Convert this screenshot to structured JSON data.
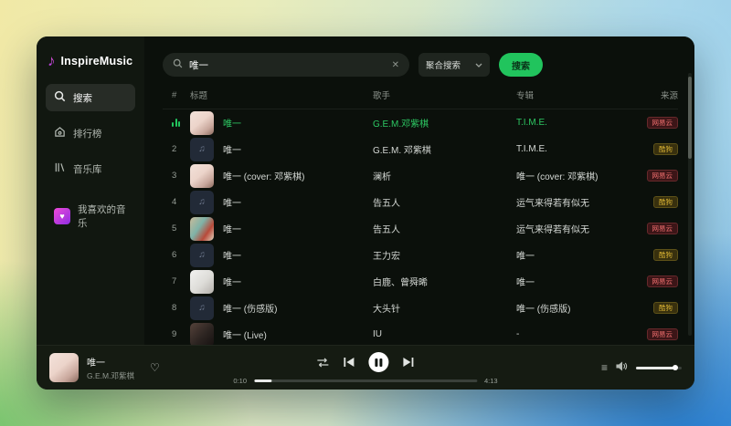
{
  "app": {
    "name": "InspireMusic"
  },
  "icons": {
    "logo_note": "♪",
    "heart_tile": "♥",
    "heart_outline": "♡",
    "clear": "✕",
    "note_placeholder": "♫",
    "queue": "≡"
  },
  "colors": {
    "accent_green": "#21c45d",
    "playing_green": "#2dc863",
    "badge_red": "#ef6e6e",
    "badge_yellow": "#d9b233",
    "logo_pink": "#f25ad2"
  },
  "sidebar": {
    "items": [
      {
        "label": "搜索",
        "icon": "search-icon",
        "active": true
      },
      {
        "label": "排行榜",
        "icon": "home-icon",
        "active": false
      },
      {
        "label": "音乐库",
        "icon": "library-icon",
        "active": false
      }
    ],
    "liked_label": "我喜欢的音乐"
  },
  "search": {
    "query": "唯一",
    "mode": "聚合搜索",
    "button_label": "搜索"
  },
  "table": {
    "headers": {
      "index": "#",
      "title": "标题",
      "artist": "歌手",
      "album": "专辑",
      "source": "来源"
    },
    "rows": [
      {
        "index": "",
        "playing": true,
        "title": "唯一",
        "artist": "G.E.M.邓紫棋",
        "album": "T.I.M.E.",
        "source": "网易云",
        "source_color": "red",
        "art": "photo1"
      },
      {
        "index": "2",
        "playing": false,
        "title": "唯一",
        "artist": "G.E.M. 邓紫棋",
        "album": "T.I.M.E.",
        "source": "酷狗",
        "source_color": "yellow",
        "art": "note"
      },
      {
        "index": "3",
        "playing": false,
        "title": "唯一 (cover: 邓紫棋)",
        "artist": "澜析",
        "album": "唯一 (cover: 邓紫棋)",
        "source": "网易云",
        "source_color": "red",
        "art": "photo1"
      },
      {
        "index": "4",
        "playing": false,
        "title": "唯一",
        "artist": "告五人",
        "album": "运气来得若有似无",
        "source": "酷狗",
        "source_color": "yellow",
        "art": "note"
      },
      {
        "index": "5",
        "playing": false,
        "title": "唯一",
        "artist": "告五人",
        "album": "运气来得若有似无",
        "source": "网易云",
        "source_color": "red",
        "art": "photo2"
      },
      {
        "index": "6",
        "playing": false,
        "title": "唯一",
        "artist": "王力宏",
        "album": "唯一",
        "source": "酷狗",
        "source_color": "yellow",
        "art": "note"
      },
      {
        "index": "7",
        "playing": false,
        "title": "唯一",
        "artist": "白鹿、曾舜晞",
        "album": "唯一",
        "source": "网易云",
        "source_color": "red",
        "art": "photo3"
      },
      {
        "index": "8",
        "playing": false,
        "title": "唯一 (伤感版)",
        "artist": "大头针",
        "album": "唯一 (伤感版)",
        "source": "酷狗",
        "source_color": "yellow",
        "art": "note"
      },
      {
        "index": "9",
        "playing": false,
        "title": "唯一 (Live)",
        "artist": "IU",
        "album": "-",
        "source": "网易云",
        "source_color": "red",
        "art": "photo4"
      }
    ]
  },
  "player": {
    "title": "唯一",
    "artist": "G.E.M.邓紫棋",
    "elapsed": "0:10",
    "duration": "4:13",
    "progress_pct": 8,
    "volume_pct": 86
  }
}
